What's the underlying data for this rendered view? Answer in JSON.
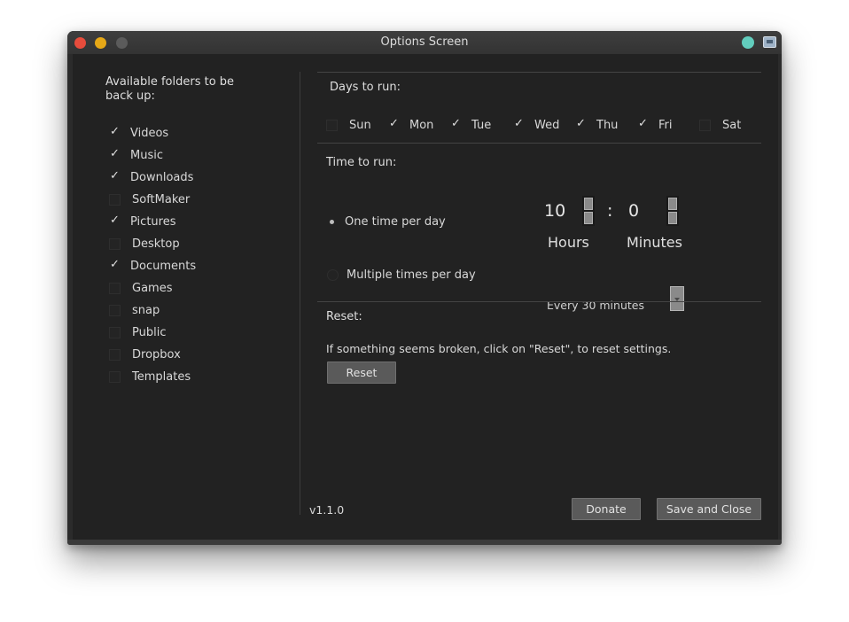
{
  "window": {
    "title": "Options Screen"
  },
  "folders": {
    "heading": "Available folders to be back up:",
    "items": [
      {
        "label": "Videos",
        "checked": true
      },
      {
        "label": "Music",
        "checked": true
      },
      {
        "label": "Downloads",
        "checked": true
      },
      {
        "label": "SoftMaker",
        "checked": false
      },
      {
        "label": "Pictures",
        "checked": true
      },
      {
        "label": "Desktop",
        "checked": false
      },
      {
        "label": "Documents",
        "checked": true
      },
      {
        "label": "Games",
        "checked": false
      },
      {
        "label": "snap",
        "checked": false
      },
      {
        "label": "Public",
        "checked": false
      },
      {
        "label": "Dropbox",
        "checked": false
      },
      {
        "label": "Templates",
        "checked": false
      }
    ]
  },
  "days": {
    "heading": "Days to run:",
    "items": [
      {
        "label": "Sun",
        "checked": false
      },
      {
        "label": "Mon",
        "checked": true
      },
      {
        "label": "Tue",
        "checked": true
      },
      {
        "label": "Wed",
        "checked": true
      },
      {
        "label": "Thu",
        "checked": true
      },
      {
        "label": "Fri",
        "checked": true
      },
      {
        "label": "Sat",
        "checked": false
      }
    ]
  },
  "time": {
    "heading": "Time to run:",
    "one_time_label": "One time per day",
    "one_time_selected": true,
    "multiple_label": "Multiple times per day",
    "multiple_selected": false,
    "hours_value": "10",
    "separator": ":",
    "minutes_value": "0",
    "hours_label": "Hours",
    "minutes_label": "Minutes",
    "interval_value": "Every 30 minutes"
  },
  "reset": {
    "heading": "Reset:",
    "message": "If something seems broken, click on \"Reset\", to reset settings.",
    "button_label": "Reset"
  },
  "footer": {
    "version": "v1.1.0",
    "donate_label": "Donate",
    "save_close_label": "Save and Close"
  },
  "colors": {
    "close": "#e74c3c",
    "minimize": "#e6a817",
    "tray_dot": "#62cdbd",
    "background": "#222222"
  }
}
